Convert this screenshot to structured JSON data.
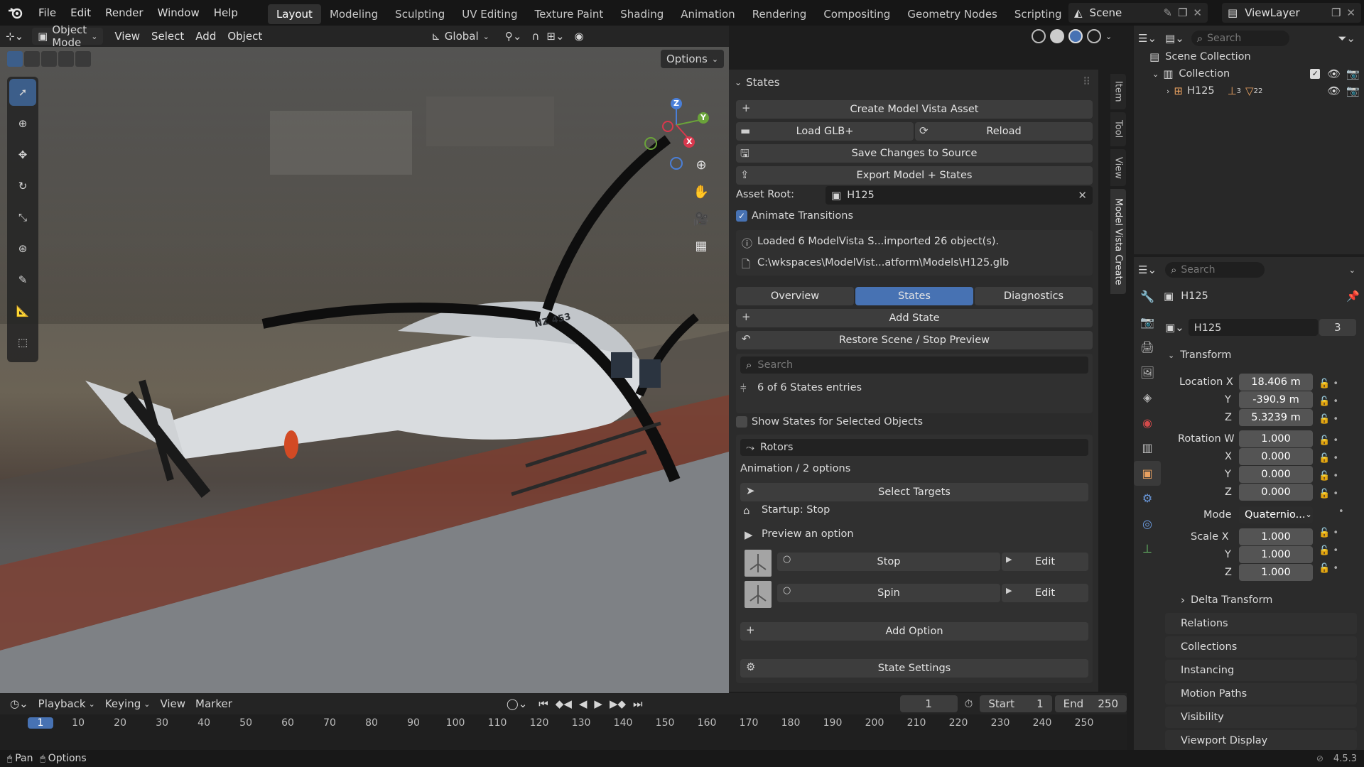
{
  "menus": [
    "File",
    "Edit",
    "Render",
    "Window",
    "Help"
  ],
  "workspaces": [
    "Layout",
    "Modeling",
    "Sculpting",
    "UV Editing",
    "Texture Paint",
    "Shading",
    "Animation",
    "Rendering",
    "Compositing",
    "Geometry Nodes",
    "Scripting"
  ],
  "scene": "Scene",
  "view_layer": "ViewLayer",
  "viewport": {
    "mode": "Object Mode",
    "menus": [
      "View",
      "Select",
      "Add",
      "Object"
    ],
    "orientation": "Global",
    "options": "Options",
    "label_nz": "NZ 453"
  },
  "gizmo": {
    "z": "Z",
    "y": "Y",
    "x": "X"
  },
  "npanel": {
    "header": "States",
    "create": "Create Model Vista Asset",
    "load": "Load GLB+",
    "reload": "Reload",
    "save": "Save Changes to Source",
    "export": "Export Model + States",
    "asset_root_label": "Asset Root:",
    "asset_root": "H125",
    "animate": "Animate Transitions",
    "info1": "Loaded 6 ModelVista S...imported 26 object(s).",
    "info2": "C:\\wkspaces\\ModelVist...atform\\Models\\H125.glb",
    "tabs": [
      "Overview",
      "States",
      "Diagnostics"
    ],
    "add_state": "Add State",
    "restore": "Restore Scene / Stop Preview",
    "search_ph": "Search",
    "entries": "6 of 6 States entries",
    "show_sel": "Show States for Selected Objects",
    "group": "Rotors",
    "anim": "Animation / 2 options",
    "select_targets": "Select Targets",
    "startup": "Startup: Stop",
    "preview": "Preview an option",
    "options": [
      {
        "name": "Stop",
        "edit": "Edit"
      },
      {
        "name": "Spin",
        "edit": "Edit"
      }
    ],
    "add_option": "Add Option",
    "state_settings": "State Settings"
  },
  "side_tabs": [
    "Item",
    "Tool",
    "View",
    "Model Vista Create"
  ],
  "outliner": {
    "search_ph": "Search",
    "scene_collection": "Scene Collection",
    "collection": "Collection",
    "object": "H125",
    "sub1": "3",
    "sub2": "22"
  },
  "props": {
    "search_ph": "Search",
    "object": "H125",
    "data_name": "H125",
    "users": "3",
    "transform": "Transform",
    "loc_label": "Location X",
    "loc": [
      "18.406 m",
      "-390.9 m",
      "5.3239 m"
    ],
    "rot_label": "Rotation W",
    "rot": [
      "1.000",
      "0.000",
      "0.000",
      "0.000"
    ],
    "mode_label": "Mode",
    "mode": "Quaternio...",
    "scale_label": "Scale X",
    "scale": [
      "1.000",
      "1.000",
      "1.000"
    ],
    "axes": [
      "Y",
      "Z",
      "X",
      "Y",
      "Z"
    ],
    "sections": [
      "Delta Transform",
      "Relations",
      "Collections",
      "Instancing",
      "Motion Paths",
      "Visibility",
      "Viewport Display"
    ]
  },
  "timeline": {
    "menus": [
      "Playback",
      "Keying",
      "View",
      "Marker"
    ],
    "frame": "1",
    "start_label": "Start",
    "start": "1",
    "end_label": "End",
    "end": "250",
    "ticks": [
      "1",
      "10",
      "20",
      "30",
      "40",
      "50",
      "60",
      "70",
      "80",
      "90",
      "100",
      "110",
      "120",
      "130",
      "140",
      "150",
      "160",
      "170",
      "180",
      "190",
      "200",
      "210",
      "220",
      "230",
      "240",
      "250"
    ]
  },
  "status": {
    "pan": "Pan",
    "options": "Options",
    "version": "4.5.3"
  }
}
